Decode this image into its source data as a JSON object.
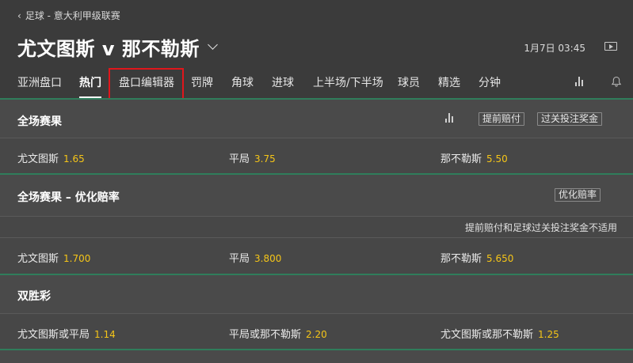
{
  "breadcrumb": {
    "text": "足球 - 意大利甲级联赛"
  },
  "match": {
    "title": "尤文图斯 v 那不勒斯",
    "datetime": "1月7日 03:45"
  },
  "tabs": [
    {
      "label": "亚洲盘口"
    },
    {
      "label": "热门"
    },
    {
      "label": "盘口编辑器"
    },
    {
      "label": "罚牌"
    },
    {
      "label": "角球"
    },
    {
      "label": "进球"
    },
    {
      "label": "上半场/下半场"
    },
    {
      "label": "球员"
    },
    {
      "label": "精选"
    },
    {
      "label": "分钟"
    }
  ],
  "sections": {
    "fulltime": {
      "title": "全场赛果",
      "badges": [
        "提前赔付",
        "过关投注奖金"
      ],
      "outcomes": [
        {
          "name": "尤文图斯",
          "odds": "1.65"
        },
        {
          "name": "平局",
          "odds": "3.75"
        },
        {
          "name": "那不勒斯",
          "odds": "5.50"
        }
      ]
    },
    "enhanced": {
      "title": "全场赛果 – 优化赔率",
      "badge": "优化赔率",
      "note": "提前赔付和足球过关投注奖金不适用",
      "outcomes": [
        {
          "name": "尤文图斯",
          "odds": "1.700"
        },
        {
          "name": "平局",
          "odds": "3.800"
        },
        {
          "name": "那不勒斯",
          "odds": "5.650"
        }
      ]
    },
    "double": {
      "title": "双胜彩",
      "outcomes": [
        {
          "name": "尤文图斯或平局",
          "odds": "1.14"
        },
        {
          "name": "平局或那不勒斯",
          "odds": "2.20"
        },
        {
          "name": "尤文图斯或那不勒斯",
          "odds": "1.25"
        }
      ]
    }
  }
}
